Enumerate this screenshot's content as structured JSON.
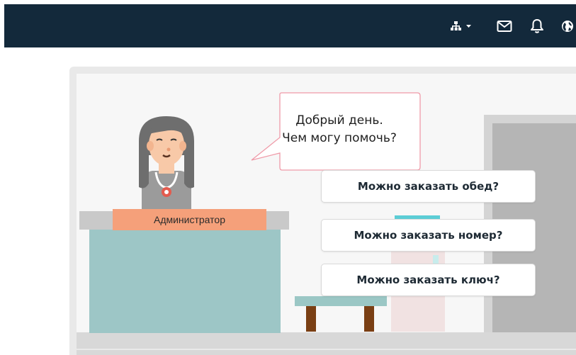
{
  "topbar": {
    "background": "#13293b",
    "icons": [
      "sitemap-icon",
      "mail-icon",
      "bell-icon",
      "globe-icon"
    ]
  },
  "scene": {
    "speech": {
      "line1": "Добрый день.",
      "line2": "Чем могу помочь?"
    },
    "admin_label": "Администратор",
    "label_color": "#f5a07a"
  },
  "options": [
    {
      "label": "Можно заказать обед?"
    },
    {
      "label": "Можно заказать номер?"
    },
    {
      "label": "Можно заказать ключ?"
    }
  ]
}
